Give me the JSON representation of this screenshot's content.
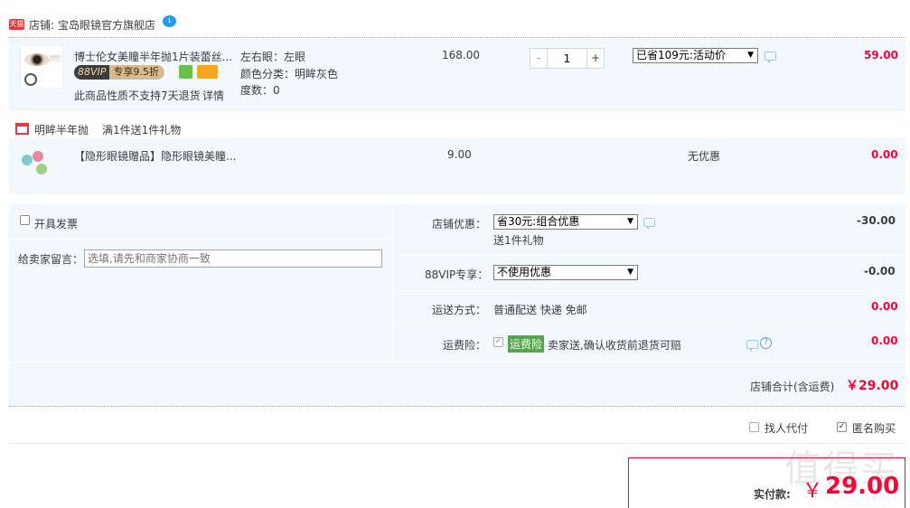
{
  "shop": {
    "badge": "天猫",
    "label": "店铺:",
    "name": "宝岛眼镜官方旗舰店"
  },
  "item": {
    "title": "博士伦女美瞳半年抛1片装蕾丝...",
    "vip_label": "88VIP",
    "vip_discount": "专享9.5折",
    "notice": "此商品性质不支持7天退货",
    "notice_link": "详情",
    "spec_eye": "左右眼：左眼",
    "spec_color": "颜色分类：明眸灰色",
    "spec_degree": "度数：0",
    "price": "168.00",
    "qty": "1",
    "qty_minus": "-",
    "qty_plus": "+",
    "promo_select": "已省109元:活动价",
    "subtotal": "59.00"
  },
  "gift_promo": {
    "label": "明眸半年抛",
    "desc": "满1件送1件礼物"
  },
  "gift": {
    "title": "【隐形眼镜赠品】隐形眼镜美瞳...",
    "price": "9.00",
    "discount": "无优惠",
    "subtotal": "0.00"
  },
  "order": {
    "invoice_label": "开具发票",
    "memo_label": "给卖家留言：",
    "memo_placeholder": "选填,请先和商家协商一致",
    "shop_discount_label": "店铺优惠：",
    "shop_discount_select": "省30元:组合优惠",
    "shop_discount_sub": "送1件礼物",
    "shop_discount_value": "-30.00",
    "vip_label": "88VIP专享：",
    "vip_select": "不使用优惠",
    "vip_value": "-0.00",
    "shipping_label": "运送方式：",
    "shipping_text": "普通配送 快递 免邮",
    "shipping_value": "0.00",
    "insurance_label": "运费险：",
    "insurance_tag": "运费险",
    "insurance_text": "卖家送,确认收货前退货可赔",
    "insurance_value": "0.00",
    "shop_total_label": "店铺合计(含运费)",
    "shop_total_value": "￥29.00"
  },
  "options": {
    "proxy_pay": "找人代付",
    "anonymous": "匿名购买"
  },
  "payment": {
    "label": "实付款:",
    "currency": "￥",
    "amount": "29.00"
  },
  "watermark": "值得买",
  "colors": {
    "accent": "#ff0036",
    "row_bg": "#f3f8fe",
    "link": "#3c3c3c",
    "insurance_tag": "#56a54c"
  }
}
